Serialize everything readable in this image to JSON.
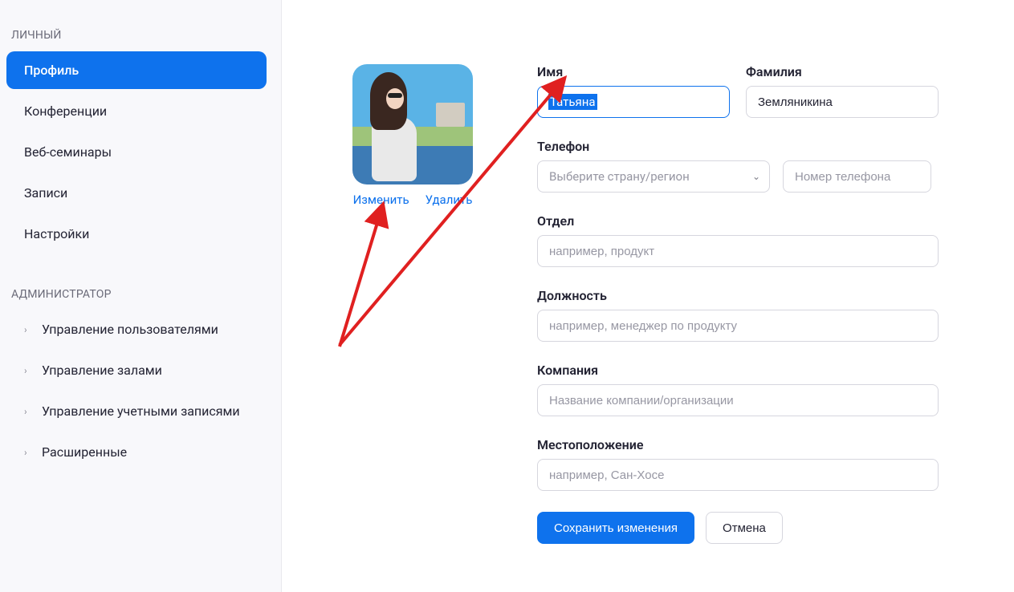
{
  "sidebar": {
    "section1_title": "ЛИЧНЫЙ",
    "items1": [
      {
        "label": "Профиль",
        "active": true
      },
      {
        "label": "Конференции"
      },
      {
        "label": "Веб-семинары"
      },
      {
        "label": "Записи"
      },
      {
        "label": "Настройки"
      }
    ],
    "section2_title": "АДМИНИСТРАТОР",
    "items2": [
      {
        "label": "Управление пользователями",
        "expandable": true
      },
      {
        "label": "Управление залами",
        "expandable": true
      },
      {
        "label": "Управление учетными записями",
        "expandable": true
      },
      {
        "label": "Расширенные",
        "expandable": true
      }
    ]
  },
  "avatar": {
    "edit": "Изменить",
    "delete": "Удалить"
  },
  "form": {
    "first_name_label": "Имя",
    "first_name_value": "Татьяна",
    "last_name_label": "Фамилия",
    "last_name_value": "Земляникина",
    "phone_label": "Телефон",
    "phone_country_placeholder": "Выберите страну/регион",
    "phone_number_placeholder": "Номер телефона",
    "department_label": "Отдел",
    "department_placeholder": "например, продукт",
    "position_label": "Должность",
    "position_placeholder": "например, менеджер по продукту",
    "company_label": "Компания",
    "company_placeholder": "Название компании/организации",
    "location_label": "Местоположение",
    "location_placeholder": "например, Сан-Хосе",
    "save_button": "Сохранить изменения",
    "cancel_button": "Отмена"
  }
}
